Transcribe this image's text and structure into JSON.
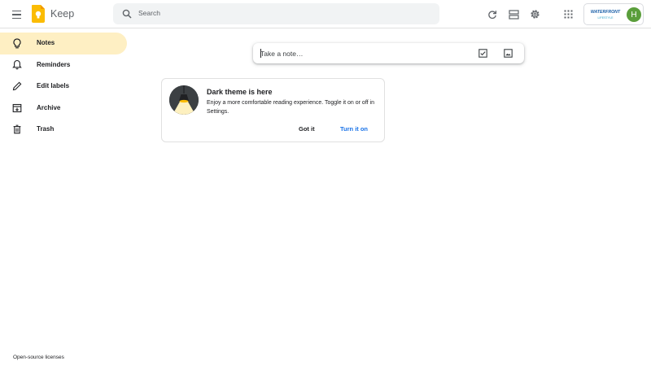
{
  "header": {
    "app_title": "Keep",
    "search_placeholder": "Search",
    "icons": [
      "menu-icon",
      "keep-logo-icon",
      "search-icon",
      "refresh-icon",
      "list-view-icon",
      "settings-icon",
      "apps-grid-icon"
    ],
    "account": {
      "org_logo_line1": "WATERFRONT",
      "org_logo_line2": "LIFESTYLE",
      "avatar_initial": "H"
    }
  },
  "sidebar": {
    "items": [
      {
        "label": "Notes",
        "icon": "lightbulb-icon",
        "active": true
      },
      {
        "label": "Reminders",
        "icon": "bell-icon",
        "active": false
      },
      {
        "label": "Edit labels",
        "icon": "pencil-icon",
        "active": false
      },
      {
        "label": "Archive",
        "icon": "archive-icon",
        "active": false
      },
      {
        "label": "Trash",
        "icon": "trash-icon",
        "active": false
      }
    ],
    "footer_link": "Open-source licenses"
  },
  "take_note": {
    "placeholder": "Take a note…",
    "icons": [
      "checkbox-icon",
      "image-icon"
    ]
  },
  "promo": {
    "title": "Dark theme is here",
    "body": "Enjoy a more comfortable reading experience. Toggle it on or off in Settings.",
    "secondary_button": "Got it",
    "primary_button": "Turn it on"
  },
  "colors": {
    "active_nav_bg": "#feefc3",
    "search_bg": "#f1f3f4",
    "link_blue": "#1a73e8",
    "keep_yellow": "#fbbc04",
    "avatar_green": "#5a9e3b"
  }
}
